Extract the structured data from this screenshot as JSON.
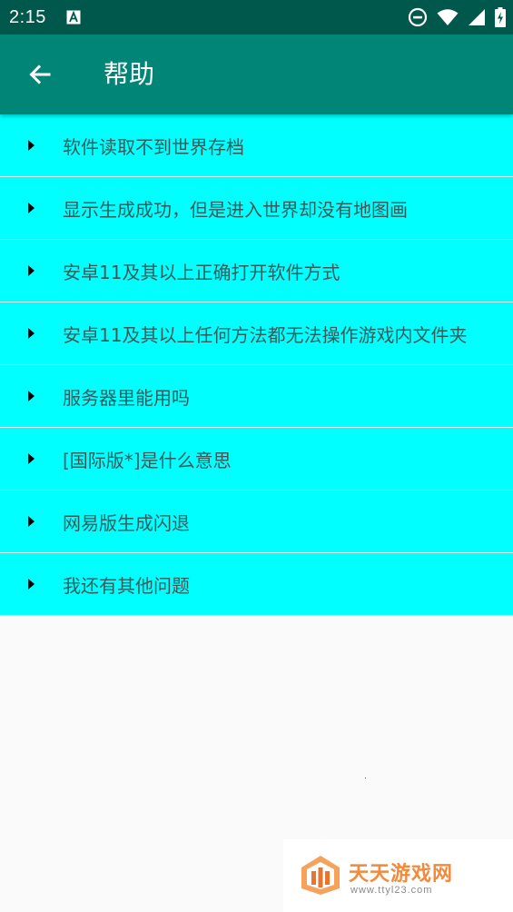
{
  "status_bar": {
    "time": "2:15",
    "icons": [
      "a-notification-icon",
      "do-not-disturb-icon",
      "wifi-icon",
      "signal-icon",
      "battery-charging-icon"
    ]
  },
  "app_bar": {
    "title": "帮助",
    "back_icon": "arrow-left-icon"
  },
  "help_items": [
    {
      "label": "软件读取不到世界存档"
    },
    {
      "label": "显示生成成功，但是进入世界却没有地图画"
    },
    {
      "label": "安卓11及其以上正确打开软件方式"
    },
    {
      "label": "安卓11及其以上任何方法都无法操作游戏内文件夹"
    },
    {
      "label": "服务器里能用吗"
    },
    {
      "label": "[国际版*]是什么意思"
    },
    {
      "label": "网易版生成闪退"
    },
    {
      "label": "我还有其他问题"
    }
  ],
  "watermark": {
    "title": "天天游戏网",
    "url": "www.ttyl23.com"
  },
  "colors": {
    "status_bar": "#00574b",
    "app_bar": "#008577",
    "list_item_bg": "#00ffff",
    "list_text": "#3a5a5a",
    "watermark_accent": "#f28a3c"
  }
}
